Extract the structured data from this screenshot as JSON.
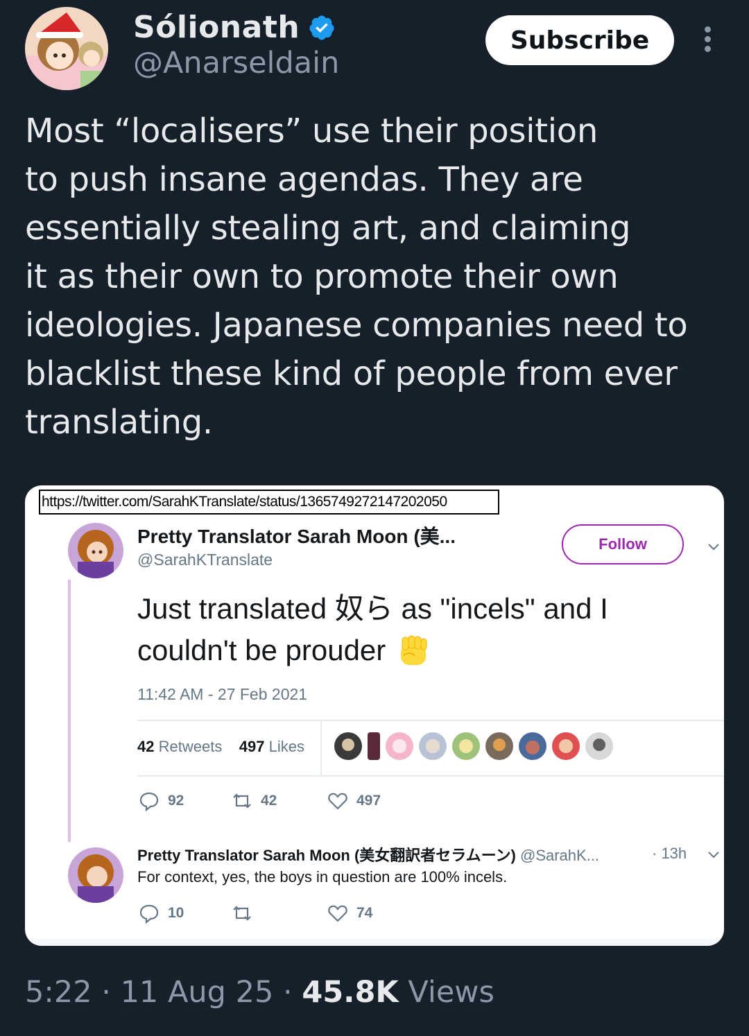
{
  "author": {
    "name": "Sólionath",
    "handle": "@Anarseldain",
    "verified": true
  },
  "subscribe_label": "Subscribe",
  "more_icon": "more-vertical-icon",
  "tweet_lines": [
    "Most “localisers” use their position",
    "to push insane agendas. They are",
    "essentially stealing art, and claiming",
    "it as their own to promote their own",
    "ideologies. Japanese companies need to",
    "blacklist these kind of people from ever",
    "translating."
  ],
  "embed": {
    "url": "https://twitter.com/SarahKTranslate/status/1365749272147202050",
    "name": "Pretty Translator Sarah Moon (美...",
    "handle": "@SarahKTranslate",
    "follow_label": "Follow",
    "text_line1": "Just translated 奴ら as \"incels\" and I",
    "text_line2": "couldn't be prouder",
    "emoji": "raised-fist-icon",
    "timestamp": "11:42 AM - 27 Feb 2021",
    "retweets_count": "42",
    "retweets_label": "Retweets",
    "likes_count": "497",
    "likes_label": "Likes",
    "actions": {
      "replies": "92",
      "retweets": "42",
      "likes": "497"
    },
    "reply": {
      "name": "Pretty Translator Sarah Moon (美女翻訳者セラムーン)",
      "handle": "@SarahK...",
      "time": "· 13h",
      "text": "For context, yes, the boys in question are 100% incels.",
      "replies": "10",
      "retweets": "",
      "likes": "74"
    }
  },
  "footer": {
    "time": "5:22 · 11 Aug 25 · ",
    "views_count": "45.8K",
    "views_label": " Views"
  },
  "colors": {
    "background": "#15202b",
    "text": "#e7e9ea",
    "muted": "#8b98a5",
    "verified": "#1d9bf0",
    "follow_accent": "#9c27b0"
  }
}
